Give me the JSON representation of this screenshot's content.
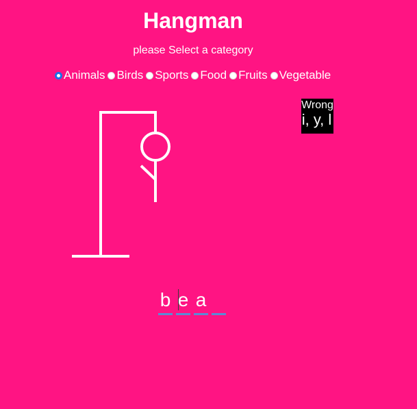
{
  "game": {
    "title": "Hangman",
    "subtitle": "please Select a category"
  },
  "categories": [
    {
      "label": "Animals",
      "selected": true
    },
    {
      "label": "Birds",
      "selected": false
    },
    {
      "label": "Sports",
      "selected": false
    },
    {
      "label": "Food",
      "selected": false
    },
    {
      "label": "Fruits",
      "selected": false
    },
    {
      "label": "Vegetable",
      "selected": false
    }
  ],
  "wrong": {
    "label": "Wrong",
    "letters": "i, y, l"
  },
  "word": {
    "slots": [
      "b",
      "e",
      "a",
      ""
    ]
  },
  "colors": {
    "background": "#ff1483",
    "foreground": "#ffffff",
    "wrong_box": "#000000",
    "slot_underline": "#5b8bd6",
    "radio_selected": "#1a73e8"
  }
}
